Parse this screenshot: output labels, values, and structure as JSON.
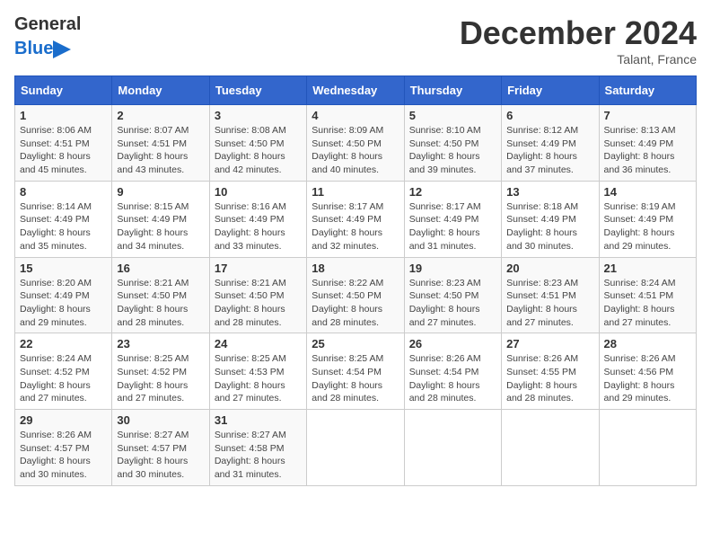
{
  "header": {
    "logo_general": "General",
    "logo_blue": "Blue",
    "month_title": "December 2024",
    "location": "Talant, France"
  },
  "days_of_week": [
    "Sunday",
    "Monday",
    "Tuesday",
    "Wednesday",
    "Thursday",
    "Friday",
    "Saturday"
  ],
  "weeks": [
    [
      {
        "day": "1",
        "sunrise": "8:06 AM",
        "sunset": "4:51 PM",
        "daylight": "8 hours and 45 minutes."
      },
      {
        "day": "2",
        "sunrise": "8:07 AM",
        "sunset": "4:51 PM",
        "daylight": "8 hours and 43 minutes."
      },
      {
        "day": "3",
        "sunrise": "8:08 AM",
        "sunset": "4:50 PM",
        "daylight": "8 hours and 42 minutes."
      },
      {
        "day": "4",
        "sunrise": "8:09 AM",
        "sunset": "4:50 PM",
        "daylight": "8 hours and 40 minutes."
      },
      {
        "day": "5",
        "sunrise": "8:10 AM",
        "sunset": "4:50 PM",
        "daylight": "8 hours and 39 minutes."
      },
      {
        "day": "6",
        "sunrise": "8:12 AM",
        "sunset": "4:49 PM",
        "daylight": "8 hours and 37 minutes."
      },
      {
        "day": "7",
        "sunrise": "8:13 AM",
        "sunset": "4:49 PM",
        "daylight": "8 hours and 36 minutes."
      }
    ],
    [
      {
        "day": "8",
        "sunrise": "8:14 AM",
        "sunset": "4:49 PM",
        "daylight": "8 hours and 35 minutes."
      },
      {
        "day": "9",
        "sunrise": "8:15 AM",
        "sunset": "4:49 PM",
        "daylight": "8 hours and 34 minutes."
      },
      {
        "day": "10",
        "sunrise": "8:16 AM",
        "sunset": "4:49 PM",
        "daylight": "8 hours and 33 minutes."
      },
      {
        "day": "11",
        "sunrise": "8:17 AM",
        "sunset": "4:49 PM",
        "daylight": "8 hours and 32 minutes."
      },
      {
        "day": "12",
        "sunrise": "8:17 AM",
        "sunset": "4:49 PM",
        "daylight": "8 hours and 31 minutes."
      },
      {
        "day": "13",
        "sunrise": "8:18 AM",
        "sunset": "4:49 PM",
        "daylight": "8 hours and 30 minutes."
      },
      {
        "day": "14",
        "sunrise": "8:19 AM",
        "sunset": "4:49 PM",
        "daylight": "8 hours and 29 minutes."
      }
    ],
    [
      {
        "day": "15",
        "sunrise": "8:20 AM",
        "sunset": "4:49 PM",
        "daylight": "8 hours and 29 minutes."
      },
      {
        "day": "16",
        "sunrise": "8:21 AM",
        "sunset": "4:50 PM",
        "daylight": "8 hours and 28 minutes."
      },
      {
        "day": "17",
        "sunrise": "8:21 AM",
        "sunset": "4:50 PM",
        "daylight": "8 hours and 28 minutes."
      },
      {
        "day": "18",
        "sunrise": "8:22 AM",
        "sunset": "4:50 PM",
        "daylight": "8 hours and 28 minutes."
      },
      {
        "day": "19",
        "sunrise": "8:23 AM",
        "sunset": "4:50 PM",
        "daylight": "8 hours and 27 minutes."
      },
      {
        "day": "20",
        "sunrise": "8:23 AM",
        "sunset": "4:51 PM",
        "daylight": "8 hours and 27 minutes."
      },
      {
        "day": "21",
        "sunrise": "8:24 AM",
        "sunset": "4:51 PM",
        "daylight": "8 hours and 27 minutes."
      }
    ],
    [
      {
        "day": "22",
        "sunrise": "8:24 AM",
        "sunset": "4:52 PM",
        "daylight": "8 hours and 27 minutes."
      },
      {
        "day": "23",
        "sunrise": "8:25 AM",
        "sunset": "4:52 PM",
        "daylight": "8 hours and 27 minutes."
      },
      {
        "day": "24",
        "sunrise": "8:25 AM",
        "sunset": "4:53 PM",
        "daylight": "8 hours and 27 minutes."
      },
      {
        "day": "25",
        "sunrise": "8:25 AM",
        "sunset": "4:54 PM",
        "daylight": "8 hours and 28 minutes."
      },
      {
        "day": "26",
        "sunrise": "8:26 AM",
        "sunset": "4:54 PM",
        "daylight": "8 hours and 28 minutes."
      },
      {
        "day": "27",
        "sunrise": "8:26 AM",
        "sunset": "4:55 PM",
        "daylight": "8 hours and 28 minutes."
      },
      {
        "day": "28",
        "sunrise": "8:26 AM",
        "sunset": "4:56 PM",
        "daylight": "8 hours and 29 minutes."
      }
    ],
    [
      {
        "day": "29",
        "sunrise": "8:26 AM",
        "sunset": "4:57 PM",
        "daylight": "8 hours and 30 minutes."
      },
      {
        "day": "30",
        "sunrise": "8:27 AM",
        "sunset": "4:57 PM",
        "daylight": "8 hours and 30 minutes."
      },
      {
        "day": "31",
        "sunrise": "8:27 AM",
        "sunset": "4:58 PM",
        "daylight": "8 hours and 31 minutes."
      },
      null,
      null,
      null,
      null
    ]
  ]
}
